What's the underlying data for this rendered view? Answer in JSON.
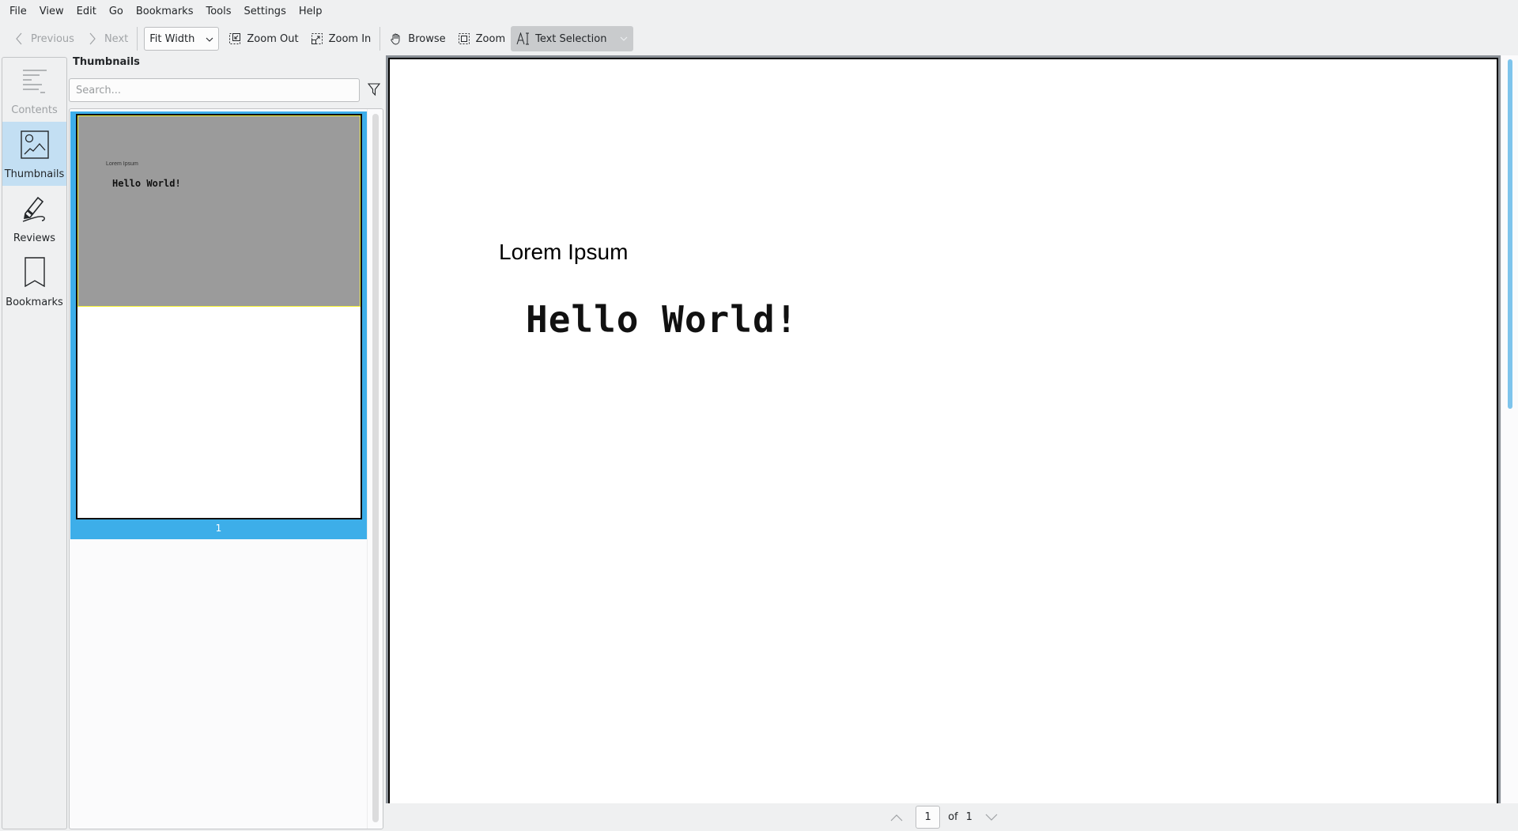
{
  "menubar": {
    "items": [
      "File",
      "View",
      "Edit",
      "Go",
      "Bookmarks",
      "Tools",
      "Settings",
      "Help"
    ]
  },
  "toolbar": {
    "previous_label": "Previous",
    "next_label": "Next",
    "zoom_mode": "Fit Width",
    "zoom_out_label": "Zoom Out",
    "zoom_in_label": "Zoom In",
    "browse_label": "Browse",
    "zoom_label": "Zoom",
    "text_selection_label": "Text Selection"
  },
  "sidebar": {
    "items": [
      {
        "label": "Contents",
        "icon": "table-of-contents-icon",
        "state": "disabled"
      },
      {
        "label": "Thumbnails",
        "icon": "image-icon",
        "state": "selected"
      },
      {
        "label": "Reviews",
        "icon": "pen-icon",
        "state": "normal"
      },
      {
        "label": "Bookmarks",
        "icon": "bookmark-icon",
        "state": "normal"
      }
    ]
  },
  "thumbnails_panel": {
    "title": "Thumbnails",
    "search_placeholder": "Search...",
    "search_value": "",
    "pages": [
      {
        "number": "1",
        "lorem": "Lorem Ipsum",
        "hello": "Hello World!",
        "selected": true
      }
    ]
  },
  "document": {
    "heading": "Lorem Ipsum",
    "body": "Hello World!"
  },
  "pagebar": {
    "current_page": "1",
    "of_label": "of",
    "total_pages": "1"
  },
  "colors": {
    "accent": "#3daee9",
    "selected_sidebar": "#c3dff3",
    "scrollbar": "#7ec4ec",
    "background": "#eff0f1"
  }
}
